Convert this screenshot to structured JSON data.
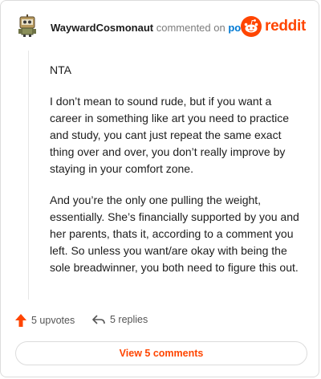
{
  "header": {
    "username": "WaywardCosmonaut",
    "commented_on": "commented on",
    "post_link": "post",
    "brand": "reddit",
    "avatar_icon": "robot-avatar-icon",
    "brand_color": "#ff4500"
  },
  "comment": {
    "paragraphs": [
      "NTA",
      "I don’t mean to sound rude, but if you want a career in something like art you need to practice and study, you cant just repeat the same exact thing over and over, you don’t really improve by staying in your comfort zone.",
      "And you’re the only one pulling the weight, essentially. She’s financially supported by you and her parents, thats it, according to a comment you left. So unless you want/are okay with being the sole breadwinner, you both need to figure this out."
    ]
  },
  "actions": {
    "upvotes_label": "5 upvotes",
    "replies_label": "5 replies"
  },
  "footer": {
    "view_comments_label": "View 5 comments"
  }
}
